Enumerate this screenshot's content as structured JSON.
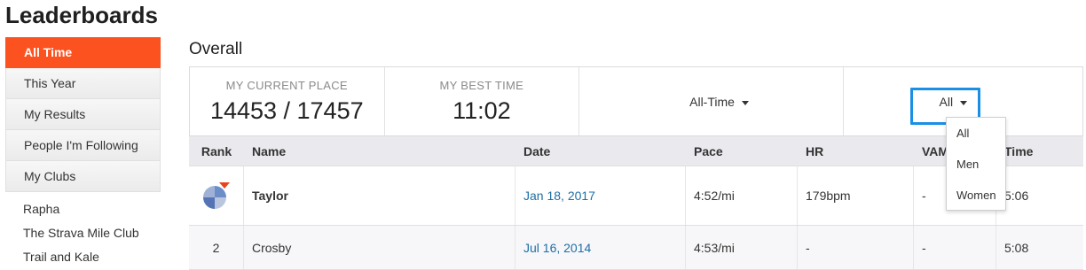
{
  "page_title": "Leaderboards",
  "sidebar": {
    "tabs": [
      {
        "label": "All Time",
        "active": true
      },
      {
        "label": "This Year"
      },
      {
        "label": "My Results"
      },
      {
        "label": "People I'm Following"
      },
      {
        "label": "My Clubs"
      }
    ],
    "clubs": [
      "Rapha",
      "The Strava Mile Club",
      "Trail and Kale"
    ]
  },
  "section_title": "Overall",
  "summary": {
    "current_place_label": "MY CURRENT PLACE",
    "current_place_value": "14453 / 17457",
    "best_time_label": "MY BEST TIME",
    "best_time_value": "11:02",
    "time_filter": "All-Time",
    "gender_filter": "All"
  },
  "gender_menu": [
    "All",
    "Men",
    "Women"
  ],
  "table": {
    "headers": [
      "Rank",
      "Name",
      "Date",
      "Pace",
      "HR",
      "VAM",
      "Time"
    ],
    "rows": [
      {
        "rank": "",
        "name": "Taylor",
        "date": "Jan 18, 2017",
        "pace": "4:52/mi",
        "hr": "179bpm",
        "vam": "-",
        "time": "5:06"
      },
      {
        "rank": "2",
        "name": "Crosby",
        "date": "Jul 16, 2014",
        "pace": "4:53/mi",
        "hr": "-",
        "vam": "-",
        "time": "5:08"
      }
    ]
  },
  "colors": {
    "accent": "#fc5220",
    "focus": "#1a8fe6",
    "link": "#1d6fa5"
  }
}
